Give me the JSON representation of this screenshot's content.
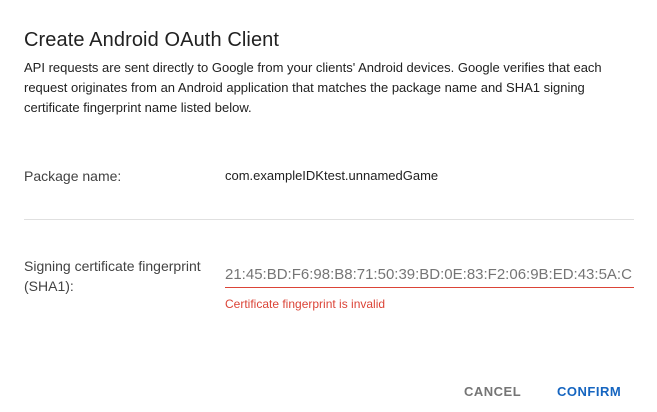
{
  "dialog": {
    "title": "Create Android OAuth Client",
    "description": "API requests are sent directly to Google from your clients' Android devices. Google verifies that each request originates from an Android application that matches the package name and SHA1 signing certificate fingerprint name listed below."
  },
  "package": {
    "label": "Package name:",
    "value": "com.exampleIDKtest.unnamedGame"
  },
  "fingerprint": {
    "label": "Signing certificate fingerprint (SHA1):",
    "value": "21:45:BD:F6:98:B8:71:50:39:BD:0E:83:F2:06:9B:ED:43:5A:C",
    "error": "Certificate fingerprint is invalid"
  },
  "actions": {
    "cancel_label": "CANCEL",
    "confirm_label": "CONFIRM"
  },
  "colors": {
    "error": "#db4437",
    "primary": "#1565c0",
    "muted": "#757575"
  }
}
